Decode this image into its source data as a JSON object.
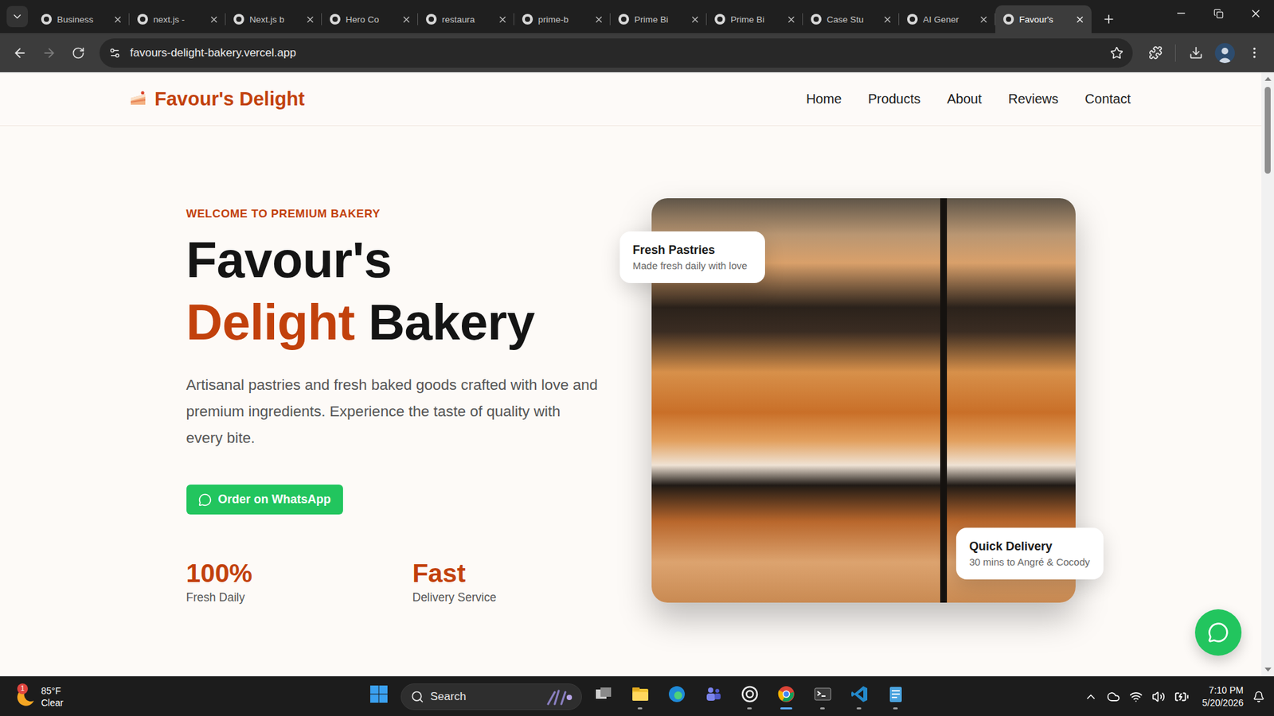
{
  "browser": {
    "tabs": [
      {
        "label": "Business",
        "selected": false
      },
      {
        "label": "next.js -",
        "selected": false
      },
      {
        "label": "Next.js b",
        "selected": false
      },
      {
        "label": "Hero Co",
        "selected": false
      },
      {
        "label": "restaura",
        "selected": false
      },
      {
        "label": "prime-b",
        "selected": false
      },
      {
        "label": "Prime Bi",
        "selected": false
      },
      {
        "label": "Prime Bi",
        "selected": false
      },
      {
        "label": "Case Stu",
        "selected": false
      },
      {
        "label": "AI Gener",
        "selected": false
      },
      {
        "label": "Favour's",
        "selected": true
      }
    ],
    "address": "favours-delight-bakery.vercel.app",
    "nav_buttons": {
      "back_disabled": false,
      "forward_disabled": true
    }
  },
  "site": {
    "logo": "Favour's Delight",
    "nav": [
      {
        "label": "Home"
      },
      {
        "label": "Products"
      },
      {
        "label": "About"
      },
      {
        "label": "Reviews"
      },
      {
        "label": "Contact"
      }
    ],
    "eyebrow": "WELCOME TO PREMIUM BAKERY",
    "heading": {
      "line1": "Favour's",
      "highlight": "Delight",
      "rest": "Bakery"
    },
    "description": "Artisanal pastries and fresh baked goods crafted with love and premium ingredients. Experience the taste of quality with every bite.",
    "button": "Order on WhatsApp",
    "stats": [
      {
        "value": "100%",
        "label": "Fresh Daily"
      },
      {
        "value": "Fast",
        "label": "Delivery Service"
      }
    ],
    "cards": [
      {
        "title": "Fresh Pastries",
        "subtitle": "Made fresh daily with love"
      },
      {
        "title": "Quick Delivery",
        "subtitle": "30 mins to Angré & Cocody"
      }
    ]
  },
  "taskbar": {
    "weather": {
      "temp": "85°F",
      "condition": "Clear",
      "badge": "1"
    },
    "search": {
      "placeholder": "Search"
    },
    "apps": [
      {
        "running": false,
        "active": false
      },
      {
        "running": true,
        "active": false
      },
      {
        "running": false,
        "active": false
      },
      {
        "running": false,
        "active": false
      },
      {
        "running": true,
        "active": false
      },
      {
        "running": true,
        "active": true
      },
      {
        "running": true,
        "active": false
      },
      {
        "running": true,
        "active": false
      },
      {
        "running": true,
        "active": false
      }
    ],
    "clock": {
      "time": "7:10 PM",
      "date": "5/20/2026"
    }
  }
}
